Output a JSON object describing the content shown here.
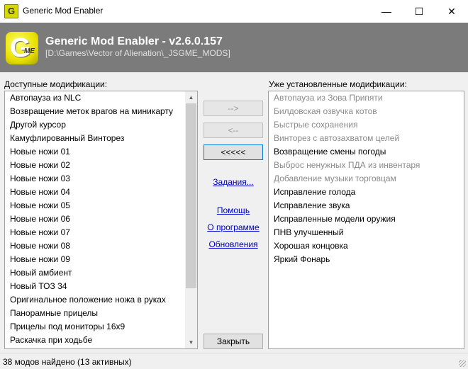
{
  "window": {
    "title": "Generic Mod Enabler",
    "minimize_glyph": "—",
    "maximize_glyph": "☐",
    "close_glyph": "✕"
  },
  "banner": {
    "title": "Generic Mod Enabler - v2.6.0.157",
    "path": "[D:\\Games\\Vector of Alienation\\_JSGME_MODS]",
    "logo_letter": "G",
    "logo_sub": "ME"
  },
  "available": {
    "label": "Доступные модификации:",
    "items": [
      "Автопауза из NLC",
      "Возвращение меток врагов на миникарту",
      "Другой курсор",
      "Камуфлированный Винторез",
      "Новые ножи 01",
      "Новые ножи 02",
      "Новые ножи 03",
      "Новые ножи 04",
      "Новые ножи 05",
      "Новые ножи 06",
      "Новые ножи 07",
      "Новые ножи 08",
      "Новые ножи 09",
      "Новый амбиент",
      "Новый ТОЗ 34",
      "Оригинальное положение ножа в руках",
      "Панорамные прицелы",
      "Прицелы под мониторы 16х9",
      "Раскачка при ходьбе"
    ]
  },
  "installed": {
    "label": "Уже установленные модификации:",
    "items": [
      {
        "text": "Автопауза из Зова Припяти",
        "dim": true
      },
      {
        "text": "Билдовская озвучка котов",
        "dim": true
      },
      {
        "text": "Быстрые сохранения",
        "dim": true
      },
      {
        "text": "Винторез с автозахватом целей",
        "dim": true
      },
      {
        "text": "Возвращение смены погоды",
        "dim": false
      },
      {
        "text": "Выброс ненужных ПДА из инвентаря",
        "dim": true
      },
      {
        "text": "Добавление музыки торговцам",
        "dim": true
      },
      {
        "text": "Исправление голода",
        "dim": false
      },
      {
        "text": "Исправление звука",
        "dim": false
      },
      {
        "text": "Исправленные модели оружия",
        "dim": false
      },
      {
        "text": "ПНВ улучшенный",
        "dim": false
      },
      {
        "text": "Хорошая концовка",
        "dim": false
      },
      {
        "text": "Яркий Фонарь",
        "dim": false
      }
    ]
  },
  "buttons": {
    "add": "-->",
    "remove": "<--",
    "remove_all": "<<<<<",
    "close": "Закрыть"
  },
  "links": {
    "tasks": "Задания...",
    "help": "Помощь",
    "about": "О программе",
    "updates": "Обновления"
  },
  "status": {
    "text": "38 модов найдено (13 активных)"
  }
}
